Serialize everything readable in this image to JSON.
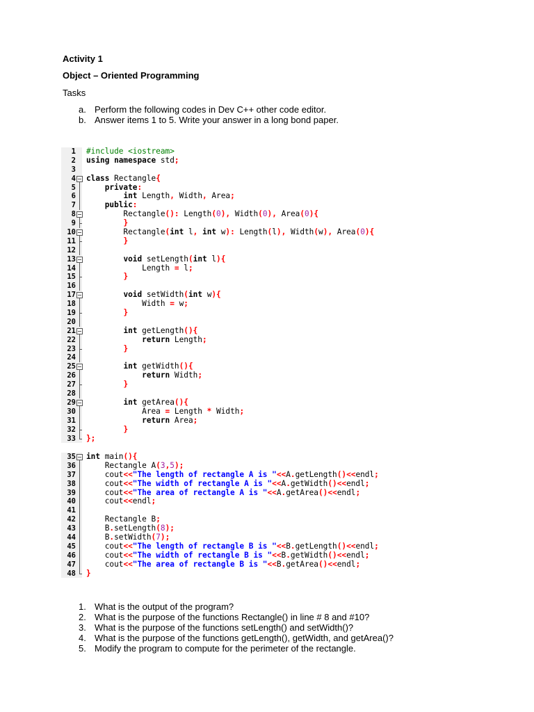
{
  "title": "Activity 1",
  "subtitle": "Object – Oriented Programming",
  "tasks_heading": "Tasks",
  "tasks": [
    {
      "marker": "a.",
      "text": "Perform the following codes in Dev C++ other code editor."
    },
    {
      "marker": "b.",
      "text": "Answer items 1 to 5. Write your answer in a long bond paper."
    }
  ],
  "code_block_1": [
    {
      "n": "1",
      "f": "",
      "c": [
        [
          "g",
          "#include <iostream>"
        ]
      ]
    },
    {
      "n": "2",
      "f": "",
      "c": [
        [
          "k",
          "using namespace"
        ],
        [
          "t",
          " std"
        ],
        [
          "p",
          ";"
        ]
      ]
    },
    {
      "n": "3",
      "f": "",
      "c": []
    },
    {
      "n": "4",
      "f": "open top",
      "c": [
        [
          "k",
          "class"
        ],
        [
          "t",
          " Rectangle"
        ],
        [
          "p",
          "{"
        ]
      ]
    },
    {
      "n": "5",
      "f": "mid",
      "c": [
        [
          "t",
          "    "
        ],
        [
          "k",
          "private"
        ],
        [
          "p",
          ":"
        ]
      ]
    },
    {
      "n": "6",
      "f": "mid",
      "c": [
        [
          "t",
          "        "
        ],
        [
          "k",
          "int"
        ],
        [
          "t",
          " Length"
        ],
        [
          "p",
          ","
        ],
        [
          "t",
          " Width"
        ],
        [
          "p",
          ","
        ],
        [
          "t",
          " Area"
        ],
        [
          "p",
          ";"
        ]
      ]
    },
    {
      "n": "7",
      "f": "mid",
      "c": [
        [
          "t",
          "    "
        ],
        [
          "k",
          "public"
        ],
        [
          "p",
          ":"
        ]
      ]
    },
    {
      "n": "8",
      "f": "open",
      "c": [
        [
          "t",
          "        Rectangle"
        ],
        [
          "p",
          "():"
        ],
        [
          "t",
          " Length"
        ],
        [
          "p",
          "("
        ],
        [
          "n",
          "0"
        ],
        [
          "p",
          "),"
        ],
        [
          "t",
          " Width"
        ],
        [
          "p",
          "("
        ],
        [
          "n",
          "0"
        ],
        [
          "p",
          "),"
        ],
        [
          "t",
          " Area"
        ],
        [
          "p",
          "("
        ],
        [
          "n",
          "0"
        ],
        [
          "p",
          "){"
        ]
      ]
    },
    {
      "n": "9",
      "f": "close",
      "c": [
        [
          "t",
          "        "
        ],
        [
          "p",
          "}"
        ]
      ]
    },
    {
      "n": "10",
      "f": "open",
      "c": [
        [
          "t",
          "        Rectangle"
        ],
        [
          "p",
          "("
        ],
        [
          "k",
          "int"
        ],
        [
          "t",
          " l"
        ],
        [
          "p",
          ","
        ],
        [
          "t",
          " "
        ],
        [
          "k",
          "int"
        ],
        [
          "t",
          " w"
        ],
        [
          "p",
          "):"
        ],
        [
          "t",
          " Length"
        ],
        [
          "p",
          "("
        ],
        [
          "t",
          "l"
        ],
        [
          "p",
          "),"
        ],
        [
          "t",
          " Width"
        ],
        [
          "p",
          "("
        ],
        [
          "t",
          "w"
        ],
        [
          "p",
          "),"
        ],
        [
          "t",
          " Area"
        ],
        [
          "p",
          "("
        ],
        [
          "n",
          "0"
        ],
        [
          "p",
          "){"
        ]
      ]
    },
    {
      "n": "11",
      "f": "close",
      "c": [
        [
          "t",
          "        "
        ],
        [
          "p",
          "}"
        ]
      ]
    },
    {
      "n": "12",
      "f": "mid",
      "c": []
    },
    {
      "n": "13",
      "f": "open",
      "c": [
        [
          "t",
          "        "
        ],
        [
          "k",
          "void"
        ],
        [
          "t",
          " setLength"
        ],
        [
          "p",
          "("
        ],
        [
          "k",
          "int"
        ],
        [
          "t",
          " l"
        ],
        [
          "p",
          "){"
        ]
      ]
    },
    {
      "n": "14",
      "f": "mid",
      "c": [
        [
          "t",
          "            Length "
        ],
        [
          "p",
          "="
        ],
        [
          "t",
          " l"
        ],
        [
          "p",
          ";"
        ]
      ]
    },
    {
      "n": "15",
      "f": "close",
      "c": [
        [
          "t",
          "        "
        ],
        [
          "p",
          "}"
        ]
      ]
    },
    {
      "n": "16",
      "f": "mid",
      "c": []
    },
    {
      "n": "17",
      "f": "open",
      "c": [
        [
          "t",
          "        "
        ],
        [
          "k",
          "void"
        ],
        [
          "t",
          " setWidth"
        ],
        [
          "p",
          "("
        ],
        [
          "k",
          "int"
        ],
        [
          "t",
          " w"
        ],
        [
          "p",
          "){"
        ]
      ]
    },
    {
      "n": "18",
      "f": "mid",
      "c": [
        [
          "t",
          "            Width "
        ],
        [
          "p",
          "="
        ],
        [
          "t",
          " w"
        ],
        [
          "p",
          ";"
        ]
      ]
    },
    {
      "n": "19",
      "f": "close",
      "c": [
        [
          "t",
          "        "
        ],
        [
          "p",
          "}"
        ]
      ]
    },
    {
      "n": "20",
      "f": "mid",
      "c": []
    },
    {
      "n": "21",
      "f": "open",
      "c": [
        [
          "t",
          "        "
        ],
        [
          "k",
          "int"
        ],
        [
          "t",
          " getLength"
        ],
        [
          "p",
          "(){"
        ]
      ]
    },
    {
      "n": "22",
      "f": "mid",
      "c": [
        [
          "t",
          "            "
        ],
        [
          "k",
          "return"
        ],
        [
          "t",
          " Length"
        ],
        [
          "p",
          ";"
        ]
      ]
    },
    {
      "n": "23",
      "f": "close",
      "c": [
        [
          "t",
          "        "
        ],
        [
          "p",
          "}"
        ]
      ]
    },
    {
      "n": "24",
      "f": "mid",
      "c": []
    },
    {
      "n": "25",
      "f": "open",
      "c": [
        [
          "t",
          "        "
        ],
        [
          "k",
          "int"
        ],
        [
          "t",
          " getWidth"
        ],
        [
          "p",
          "(){"
        ]
      ]
    },
    {
      "n": "26",
      "f": "mid",
      "c": [
        [
          "t",
          "            "
        ],
        [
          "k",
          "return"
        ],
        [
          "t",
          " Width"
        ],
        [
          "p",
          ";"
        ]
      ]
    },
    {
      "n": "27",
      "f": "close",
      "c": [
        [
          "t",
          "        "
        ],
        [
          "p",
          "}"
        ]
      ]
    },
    {
      "n": "28",
      "f": "mid",
      "c": []
    },
    {
      "n": "29",
      "f": "open",
      "c": [
        [
          "t",
          "        "
        ],
        [
          "k",
          "int"
        ],
        [
          "t",
          " getArea"
        ],
        [
          "p",
          "(){"
        ]
      ]
    },
    {
      "n": "30",
      "f": "mid",
      "c": [
        [
          "t",
          "            Area "
        ],
        [
          "p",
          "="
        ],
        [
          "t",
          " Length "
        ],
        [
          "p",
          "*"
        ],
        [
          "t",
          " Width"
        ],
        [
          "p",
          ";"
        ]
      ]
    },
    {
      "n": "31",
      "f": "mid",
      "c": [
        [
          "t",
          "            "
        ],
        [
          "k",
          "return"
        ],
        [
          "t",
          " Area"
        ],
        [
          "p",
          ";"
        ]
      ]
    },
    {
      "n": "32",
      "f": "close",
      "c": [
        [
          "t",
          "        "
        ],
        [
          "p",
          "}"
        ]
      ]
    },
    {
      "n": "33",
      "f": "end",
      "c": [
        [
          "p",
          "};"
        ]
      ]
    }
  ],
  "code_block_2": [
    {
      "n": "35",
      "f": "open top",
      "c": [
        [
          "k",
          "int"
        ],
        [
          "t",
          " main"
        ],
        [
          "p",
          "(){"
        ]
      ]
    },
    {
      "n": "36",
      "f": "mid",
      "c": [
        [
          "t",
          "    Rectangle A"
        ],
        [
          "p",
          "("
        ],
        [
          "n",
          "3"
        ],
        [
          "p",
          ","
        ],
        [
          "n",
          "5"
        ],
        [
          "p",
          ");"
        ]
      ]
    },
    {
      "n": "37",
      "f": "mid",
      "c": [
        [
          "t",
          "    cout"
        ],
        [
          "p",
          "<<"
        ],
        [
          "s",
          "\"The length of rectangle A is \""
        ],
        [
          "p",
          "<<"
        ],
        [
          "t",
          "A"
        ],
        [
          "p",
          "."
        ],
        [
          "t",
          "getLength"
        ],
        [
          "p",
          "()<<"
        ],
        [
          "t",
          "endl"
        ],
        [
          "p",
          ";"
        ]
      ]
    },
    {
      "n": "38",
      "f": "mid",
      "c": [
        [
          "t",
          "    cout"
        ],
        [
          "p",
          "<<"
        ],
        [
          "s",
          "\"The width of rectangle A is \""
        ],
        [
          "p",
          "<<"
        ],
        [
          "t",
          "A"
        ],
        [
          "p",
          "."
        ],
        [
          "t",
          "getWidth"
        ],
        [
          "p",
          "()<<"
        ],
        [
          "t",
          "endl"
        ],
        [
          "p",
          ";"
        ]
      ]
    },
    {
      "n": "39",
      "f": "mid",
      "c": [
        [
          "t",
          "    cout"
        ],
        [
          "p",
          "<<"
        ],
        [
          "s",
          "\"The area of rectangle A is \""
        ],
        [
          "p",
          "<<"
        ],
        [
          "t",
          "A"
        ],
        [
          "p",
          "."
        ],
        [
          "t",
          "getArea"
        ],
        [
          "p",
          "()<<"
        ],
        [
          "t",
          "endl"
        ],
        [
          "p",
          ";"
        ]
      ]
    },
    {
      "n": "40",
      "f": "mid",
      "c": [
        [
          "t",
          "    cout"
        ],
        [
          "p",
          "<<"
        ],
        [
          "t",
          "endl"
        ],
        [
          "p",
          ";"
        ]
      ]
    },
    {
      "n": "41",
      "f": "mid",
      "c": []
    },
    {
      "n": "42",
      "f": "mid",
      "c": [
        [
          "t",
          "    Rectangle B"
        ],
        [
          "p",
          ";"
        ]
      ]
    },
    {
      "n": "43",
      "f": "mid",
      "c": [
        [
          "t",
          "    B"
        ],
        [
          "p",
          "."
        ],
        [
          "t",
          "setLength"
        ],
        [
          "p",
          "("
        ],
        [
          "n",
          "8"
        ],
        [
          "p",
          ");"
        ]
      ]
    },
    {
      "n": "44",
      "f": "mid",
      "c": [
        [
          "t",
          "    B"
        ],
        [
          "p",
          "."
        ],
        [
          "t",
          "setWidth"
        ],
        [
          "p",
          "("
        ],
        [
          "n",
          "7"
        ],
        [
          "p",
          ");"
        ]
      ]
    },
    {
      "n": "45",
      "f": "mid",
      "c": [
        [
          "t",
          "    cout"
        ],
        [
          "p",
          "<<"
        ],
        [
          "s",
          "\"The length of rectangle B is \""
        ],
        [
          "p",
          "<<"
        ],
        [
          "t",
          "B"
        ],
        [
          "p",
          "."
        ],
        [
          "t",
          "getLength"
        ],
        [
          "p",
          "()<<"
        ],
        [
          "t",
          "endl"
        ],
        [
          "p",
          ";"
        ]
      ]
    },
    {
      "n": "46",
      "f": "mid",
      "c": [
        [
          "t",
          "    cout"
        ],
        [
          "p",
          "<<"
        ],
        [
          "s",
          "\"The width of rectangle B is \""
        ],
        [
          "p",
          "<<"
        ],
        [
          "t",
          "B"
        ],
        [
          "p",
          "."
        ],
        [
          "t",
          "getWidth"
        ],
        [
          "p",
          "()<<"
        ],
        [
          "t",
          "endl"
        ],
        [
          "p",
          ";"
        ]
      ]
    },
    {
      "n": "47",
      "f": "mid",
      "c": [
        [
          "t",
          "    cout"
        ],
        [
          "p",
          "<<"
        ],
        [
          "s",
          "\"The area of rectangle B is \""
        ],
        [
          "p",
          "<<"
        ],
        [
          "t",
          "B"
        ],
        [
          "p",
          "."
        ],
        [
          "t",
          "getArea"
        ],
        [
          "p",
          "()<<"
        ],
        [
          "t",
          "endl"
        ],
        [
          "p",
          ";"
        ]
      ]
    },
    {
      "n": "48",
      "f": "end",
      "c": [
        [
          "p",
          "}"
        ]
      ]
    }
  ],
  "questions": [
    {
      "marker": "1.",
      "text": "What is the output of the program?"
    },
    {
      "marker": "2.",
      "text": "What is the purpose of the functions Rectangle() in line # 8 and #10?"
    },
    {
      "marker": "3.",
      "text": "What is the purpose of the functions setLength() and setWidth()?"
    },
    {
      "marker": "4.",
      "text": "What is the purpose of the functions getLength(), getWidth, and getArea()?"
    },
    {
      "marker": "5.",
      "text": "Modify the program to compute for the perimeter of the rectangle."
    }
  ]
}
